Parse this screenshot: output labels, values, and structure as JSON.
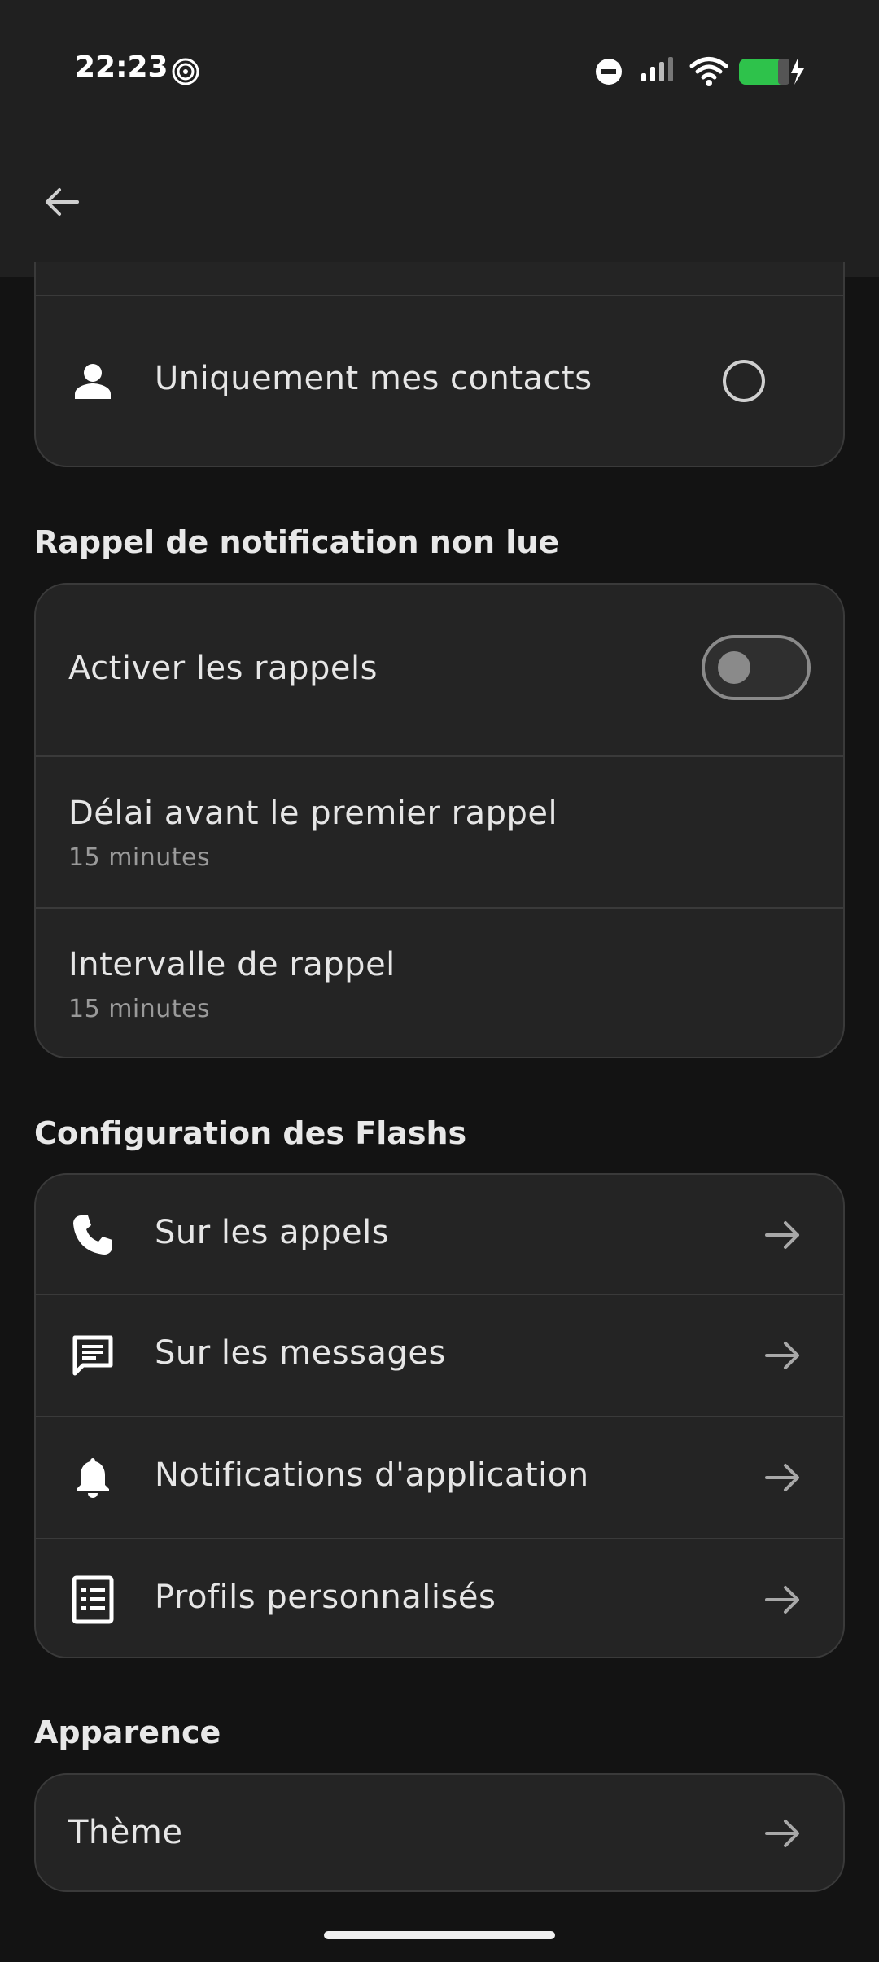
{
  "status_bar": {
    "time": "22:23",
    "left_icon": "hotspot-icon",
    "right_icons": [
      "do-not-disturb-icon",
      "signal-icon",
      "wifi-icon",
      "battery-charging-icon"
    ],
    "battery_color": "#2ec24b"
  },
  "app_bar": {
    "back_icon": "back-arrow-icon"
  },
  "contacts_card": {
    "label": "Uniquement mes contacts",
    "icon": "person-icon",
    "selected": false
  },
  "reminder_section": {
    "title": "Rappel de notification non lue",
    "enable": {
      "label": "Activer les rappels",
      "enabled": false
    },
    "first_delay": {
      "label": "Délai avant le premier rappel",
      "value": "15 minutes"
    },
    "interval": {
      "label": "Intervalle de rappel",
      "value": "15 minutes"
    }
  },
  "flash_section": {
    "title": "Configuration des Flashs",
    "items": [
      {
        "label": "Sur les appels",
        "icon": "phone-icon"
      },
      {
        "label": "Sur les messages",
        "icon": "message-icon"
      },
      {
        "label": "Notifications d'application",
        "icon": "bell-icon"
      },
      {
        "label": "Profils personnalisés",
        "icon": "document-list-icon"
      }
    ]
  },
  "appearance_section": {
    "title": "Apparence",
    "theme": {
      "label": "Thème"
    }
  },
  "colors": {
    "background": "#131313",
    "card": "#242424",
    "bar": "#202020",
    "divider": "#3a3a3a"
  }
}
